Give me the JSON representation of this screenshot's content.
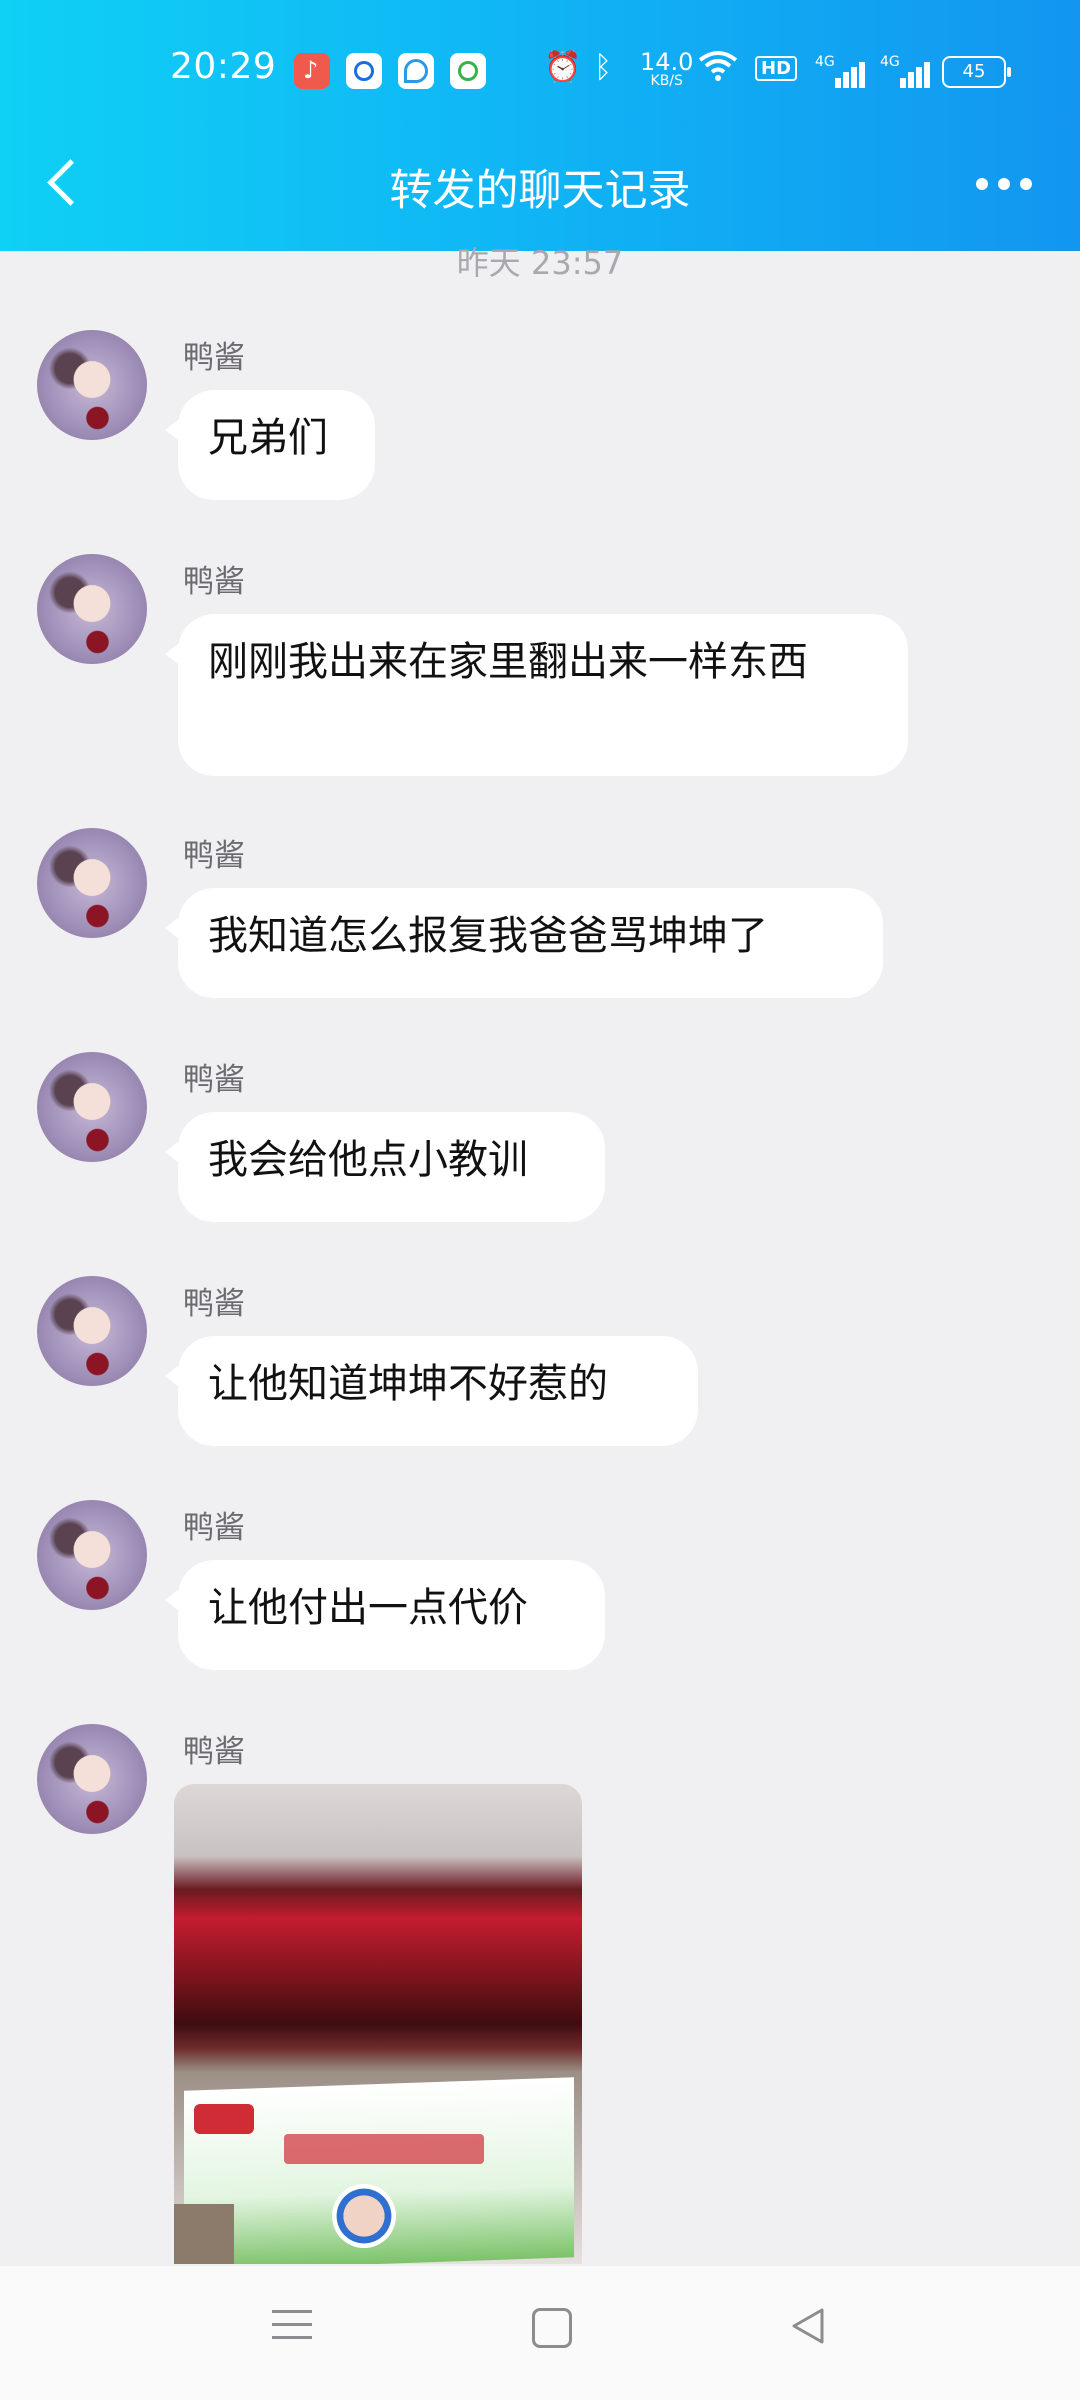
{
  "status_bar": {
    "time": "20:29",
    "net_speed_value": "14.0",
    "net_speed_unit": "KB/S",
    "hd_label": "HD",
    "sig1_label": "4G",
    "sig2_label": "4G",
    "battery": "45"
  },
  "header": {
    "title": "转发的聊天记录",
    "back_icon": "chevron-left-icon",
    "more_icon": "more-horizontal-icon"
  },
  "chat": {
    "partial_timestamp": "昨天 23:57",
    "messages": [
      {
        "sender": "鸭酱",
        "text": "兄弟们"
      },
      {
        "sender": "鸭酱",
        "text": "刚刚我出来在家里翻出来一样东西"
      },
      {
        "sender": "鸭酱",
        "text": "我知道怎么报复我爸爸骂坤坤了"
      },
      {
        "sender": "鸭酱",
        "text": "我会给他点小教训"
      },
      {
        "sender": "鸭酱",
        "text": "让他知道坤坤不好惹的"
      },
      {
        "sender": "鸭酱",
        "text": "让他付出一点代价"
      },
      {
        "sender": "鸭酱",
        "image": "photo-of-red-packets-in-box"
      }
    ]
  },
  "nav_bar": {
    "menu_icon": "menu-icon",
    "home_icon": "home-square-icon",
    "back_icon": "back-triangle-icon"
  },
  "colors": {
    "header_gradient_start": "#0fd0f5",
    "header_gradient_end": "#1296f0",
    "chat_background": "#f0f0f2",
    "bubble_background": "#ffffff"
  }
}
